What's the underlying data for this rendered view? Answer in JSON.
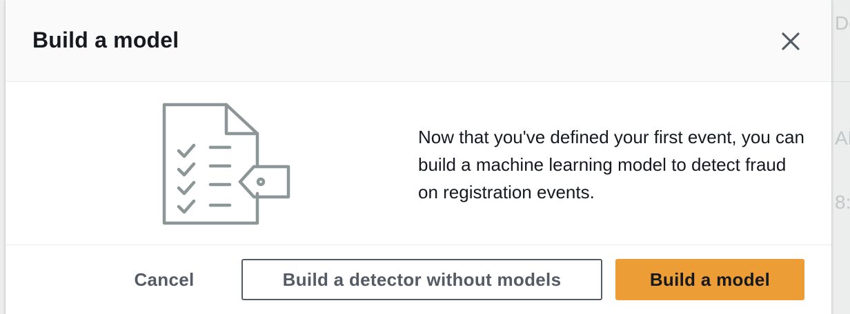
{
  "modal": {
    "title": "Build a model",
    "body_text": "Now that you've defined your first event, you can build a machine learning model to detect fraud on registration events.",
    "buttons": {
      "cancel": "Cancel",
      "secondary": "Build a detector without models",
      "primary": "Build a model"
    }
  },
  "background_fragments": {
    "top_right": "De",
    "mid_right": "AF",
    "lower_right": "8:"
  },
  "icons": {
    "close": "close-icon",
    "illustration": "document-checklist-tag-icon"
  },
  "colors": {
    "primary_button": "#ec9d35",
    "text": "#16191f",
    "secondary_text": "#545b64",
    "illustration_stroke": "#8c9696"
  }
}
